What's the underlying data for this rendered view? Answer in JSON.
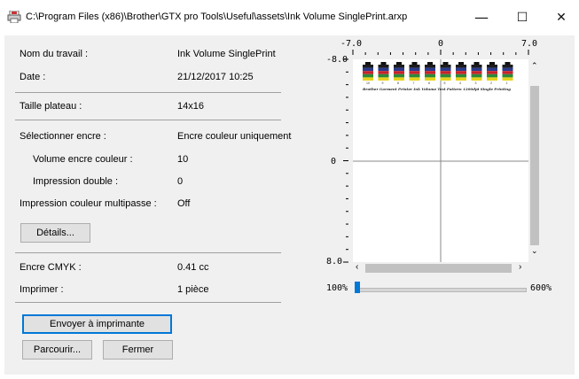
{
  "window": {
    "title": "C:\\Program Files (x86)\\Brother\\GTX pro Tools\\Useful\\assets\\Ink Volume SinglePrint.arxp",
    "minimize": "—",
    "maximize": "☐",
    "close": "✕"
  },
  "fields": [
    {
      "label": "Nom du travail :",
      "value": "Ink Volume SinglePrint"
    },
    {
      "label": "Date :",
      "value": "21/12/2017 10:25"
    },
    {
      "label": "Taille plateau :",
      "value": "14x16"
    },
    {
      "label": "Sélectionner encre :",
      "value": "Encre couleur uniquement"
    },
    {
      "label": "Volume encre couleur :",
      "value": "10"
    },
    {
      "label": "Impression double :",
      "value": "0"
    },
    {
      "label": "Impression couleur multipasse :",
      "value": "Off"
    },
    {
      "label": "Encre CMYK :",
      "value": "0.41 cc"
    },
    {
      "label": "Imprimer :",
      "value": "1 pièce"
    }
  ],
  "buttons": {
    "details": "Détails...",
    "send": "Envoyer à imprimante",
    "browse": "Parcourir...",
    "close": "Fermer"
  },
  "preview": {
    "ruler_top": [
      "-7.0",
      "0",
      "7.0"
    ],
    "ruler_left": [
      "-8.0",
      "0",
      "8.0"
    ],
    "print_caption": "Brother Garment Printer Ink Volume Test Pattern 1200dpi      Single Printing",
    "swatch_labels": [
      "10",
      "9",
      "8",
      "7",
      "6",
      "5",
      "4",
      "3",
      "2",
      "1"
    ],
    "swatch_colors": [
      "#1b1b1b",
      "#2a3a8a",
      "#c8232a",
      "#2a8a3a",
      "#e7d21e"
    ]
  },
  "zoom": {
    "min": "100%",
    "max": "600%",
    "level_fraction": 0.0
  }
}
